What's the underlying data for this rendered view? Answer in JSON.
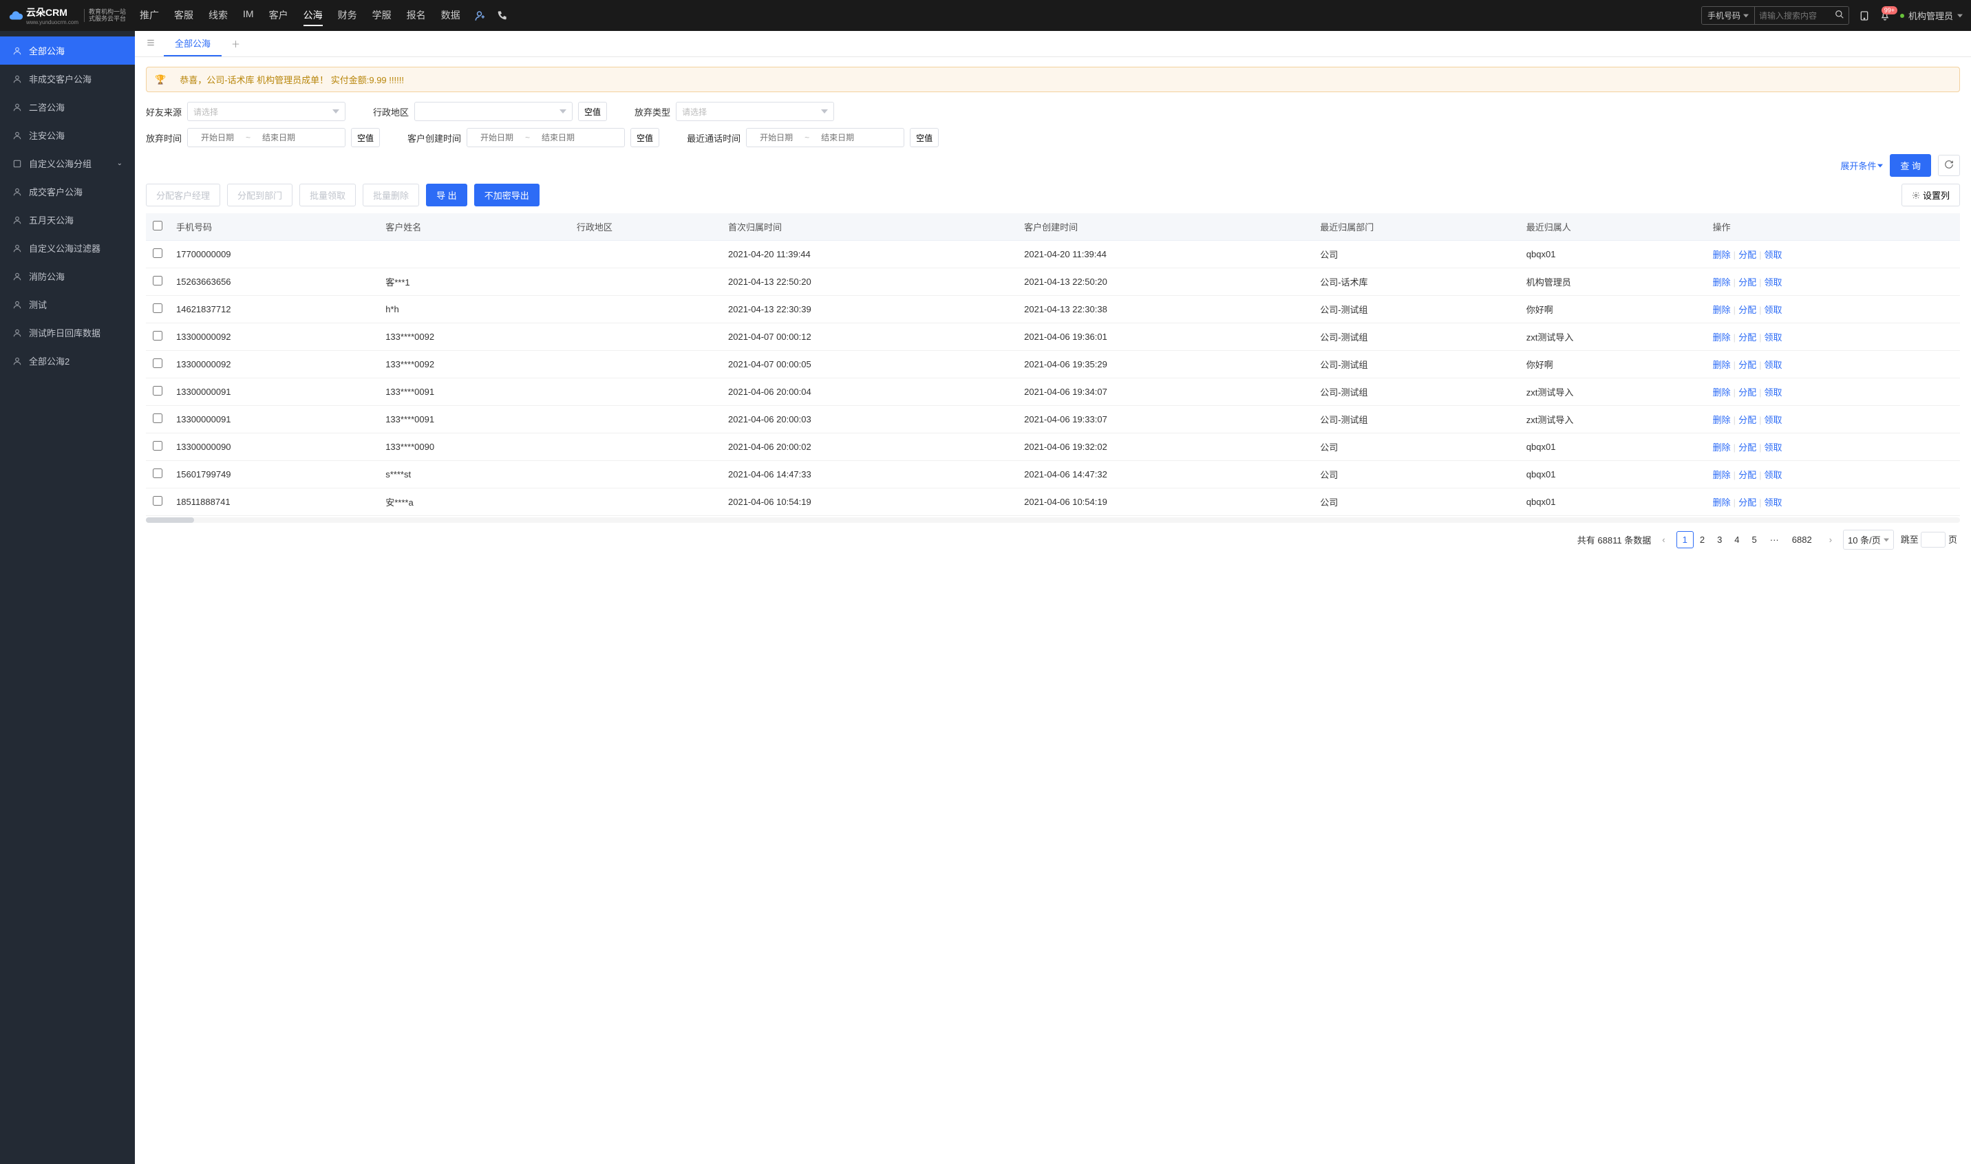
{
  "header": {
    "logo_main": "云朵CRM",
    "logo_sub1": "教育机构一站",
    "logo_sub2": "式服务云平台",
    "logo_url": "www.yunduocrm.com",
    "nav": [
      "推广",
      "客服",
      "线索",
      "IM",
      "客户",
      "公海",
      "财务",
      "学服",
      "报名",
      "数据"
    ],
    "nav_active": 5,
    "search_type": "手机号码",
    "search_placeholder": "请输入搜索内容",
    "badge": "99+",
    "user": "机构管理员"
  },
  "sidebar": [
    {
      "label": "全部公海",
      "active": true
    },
    {
      "label": "非成交客户公海"
    },
    {
      "label": "二咨公海"
    },
    {
      "label": "注安公海"
    },
    {
      "label": "自定义公海分组",
      "expand": true
    },
    {
      "label": "成交客户公海"
    },
    {
      "label": "五月天公海"
    },
    {
      "label": "自定义公海过滤器"
    },
    {
      "label": "消防公海"
    },
    {
      "label": "测试"
    },
    {
      "label": "测试昨日回库数据"
    },
    {
      "label": "全部公海2"
    }
  ],
  "tab_active": "全部公海",
  "banner": "恭喜，公司-话术库  机构管理员成单！  实付金额:9.99 !!!!!!",
  "filters": {
    "source_label": "好友来源",
    "source_placeholder": "请选择",
    "region_label": "行政地区",
    "type_label": "放弃类型",
    "type_placeholder": "请选择",
    "abandon_time_label": "放弃时间",
    "create_time_label": "客户创建时间",
    "call_time_label": "最近通话时间",
    "date_start": "开始日期",
    "date_end": "结束日期",
    "null_btn": "空值",
    "expand": "展开条件",
    "query": "查 询"
  },
  "toolbar": {
    "assign_mgr": "分配客户经理",
    "assign_dept": "分配到部门",
    "batch_claim": "批量领取",
    "batch_del": "批量删除",
    "export": "导 出",
    "export_plain": "不加密导出",
    "set_col": "设置列"
  },
  "columns": [
    "手机号码",
    "客户姓名",
    "行政地区",
    "首次归属时间",
    "客户创建时间",
    "最近归属部门",
    "最近归属人",
    "操作"
  ],
  "ops": {
    "del": "删除",
    "assign": "分配",
    "claim": "领取"
  },
  "rows": [
    {
      "phone": "17700000009",
      "name": "",
      "region": "",
      "first": "2021-04-20 11:39:44",
      "create": "2021-04-20 11:39:44",
      "dept": "公司",
      "owner": "qbqx01"
    },
    {
      "phone": "15263663656",
      "name": "客***1",
      "region": "",
      "first": "2021-04-13 22:50:20",
      "create": "2021-04-13 22:50:20",
      "dept": "公司-话术库",
      "owner": "机构管理员"
    },
    {
      "phone": "14621837712",
      "name": "h*h",
      "region": "",
      "first": "2021-04-13 22:30:39",
      "create": "2021-04-13 22:30:38",
      "dept": "公司-测试组",
      "owner": "你好啊"
    },
    {
      "phone": "13300000092",
      "name": "133****0092",
      "region": "",
      "first": "2021-04-07 00:00:12",
      "create": "2021-04-06 19:36:01",
      "dept": "公司-测试组",
      "owner": "zxt测试导入"
    },
    {
      "phone": "13300000092",
      "name": "133****0092",
      "region": "",
      "first": "2021-04-07 00:00:05",
      "create": "2021-04-06 19:35:29",
      "dept": "公司-测试组",
      "owner": "你好啊"
    },
    {
      "phone": "13300000091",
      "name": "133****0091",
      "region": "",
      "first": "2021-04-06 20:00:04",
      "create": "2021-04-06 19:34:07",
      "dept": "公司-测试组",
      "owner": "zxt测试导入"
    },
    {
      "phone": "13300000091",
      "name": "133****0091",
      "region": "",
      "first": "2021-04-06 20:00:03",
      "create": "2021-04-06 19:33:07",
      "dept": "公司-测试组",
      "owner": "zxt测试导入"
    },
    {
      "phone": "13300000090",
      "name": "133****0090",
      "region": "",
      "first": "2021-04-06 20:00:02",
      "create": "2021-04-06 19:32:02",
      "dept": "公司",
      "owner": "qbqx01"
    },
    {
      "phone": "15601799749",
      "name": "s****st",
      "region": "",
      "first": "2021-04-06 14:47:33",
      "create": "2021-04-06 14:47:32",
      "dept": "公司",
      "owner": "qbqx01"
    },
    {
      "phone": "18511888741",
      "name": "安****a",
      "region": "",
      "first": "2021-04-06 10:54:19",
      "create": "2021-04-06 10:54:19",
      "dept": "公司",
      "owner": "qbqx01"
    }
  ],
  "pager": {
    "total_prefix": "共有",
    "total": "68811",
    "total_suffix": "条数据",
    "pages": [
      "1",
      "2",
      "3",
      "4",
      "5"
    ],
    "last": "6882",
    "per_page": "10 条/页",
    "jump_label": "跳至",
    "page_suffix": "页"
  }
}
